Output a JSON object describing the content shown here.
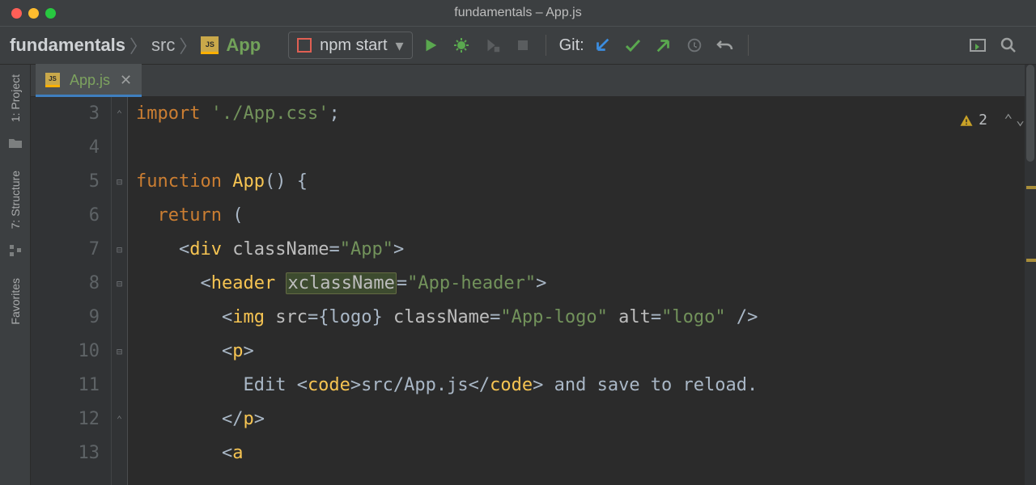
{
  "window": {
    "title": "fundamentals – App.js"
  },
  "breadcrumb": {
    "project": "fundamentals",
    "folder": "src",
    "file": "App"
  },
  "runConfig": {
    "label": "npm start"
  },
  "toolbar": {
    "git_label": "Git:"
  },
  "sidebar": {
    "project": "1: Project",
    "structure": "7: Structure",
    "favorites": "Favorites"
  },
  "tabs": [
    {
      "label": "App.js"
    }
  ],
  "inspection": {
    "warnings": "2"
  },
  "gutter": {
    "start": 3,
    "lines": [
      "3",
      "4",
      "5",
      "6",
      "7",
      "8",
      "9",
      "10",
      "11",
      "12",
      "13"
    ]
  },
  "code": {
    "l3": {
      "kw": "import",
      "str": "'./App.css'",
      "semi": ";"
    },
    "l5": {
      "kw": "function",
      "name": "App",
      "pre": "()",
      "brace": "{"
    },
    "l6": {
      "kw": "return",
      "paren": "("
    },
    "l7": {
      "open": "<",
      "tag": "div",
      "attr": "className",
      "eq": "=",
      "val": "\"App\"",
      "close": ">"
    },
    "l8": {
      "open": "<",
      "tag": "header",
      "attr": "xclassName",
      "eq": "=",
      "val": "\"App-header\"",
      "close": ">"
    },
    "l9": {
      "open": "<",
      "tag": "img",
      "a1": "src",
      "eq1": "=",
      "jsx": "{logo}",
      "a2": "className",
      "eq2": "=",
      "v2": "\"App-logo\"",
      "a3": "alt",
      "eq3": "=",
      "v3": "\"logo\"",
      "close": " />"
    },
    "l10": {
      "open": "<",
      "tag": "p",
      "close": ">"
    },
    "l11": {
      "t1": "Edit ",
      "o1": "<",
      "c1": "code",
      "cl1": ">",
      "body": "src/App.js",
      "o2": "</",
      "c2": "code",
      "cl2": ">",
      "t2": " and save to reload."
    },
    "l12": {
      "open": "</",
      "tag": "p",
      "close": ">"
    },
    "l13": {
      "open": "<",
      "tag": "a"
    }
  }
}
